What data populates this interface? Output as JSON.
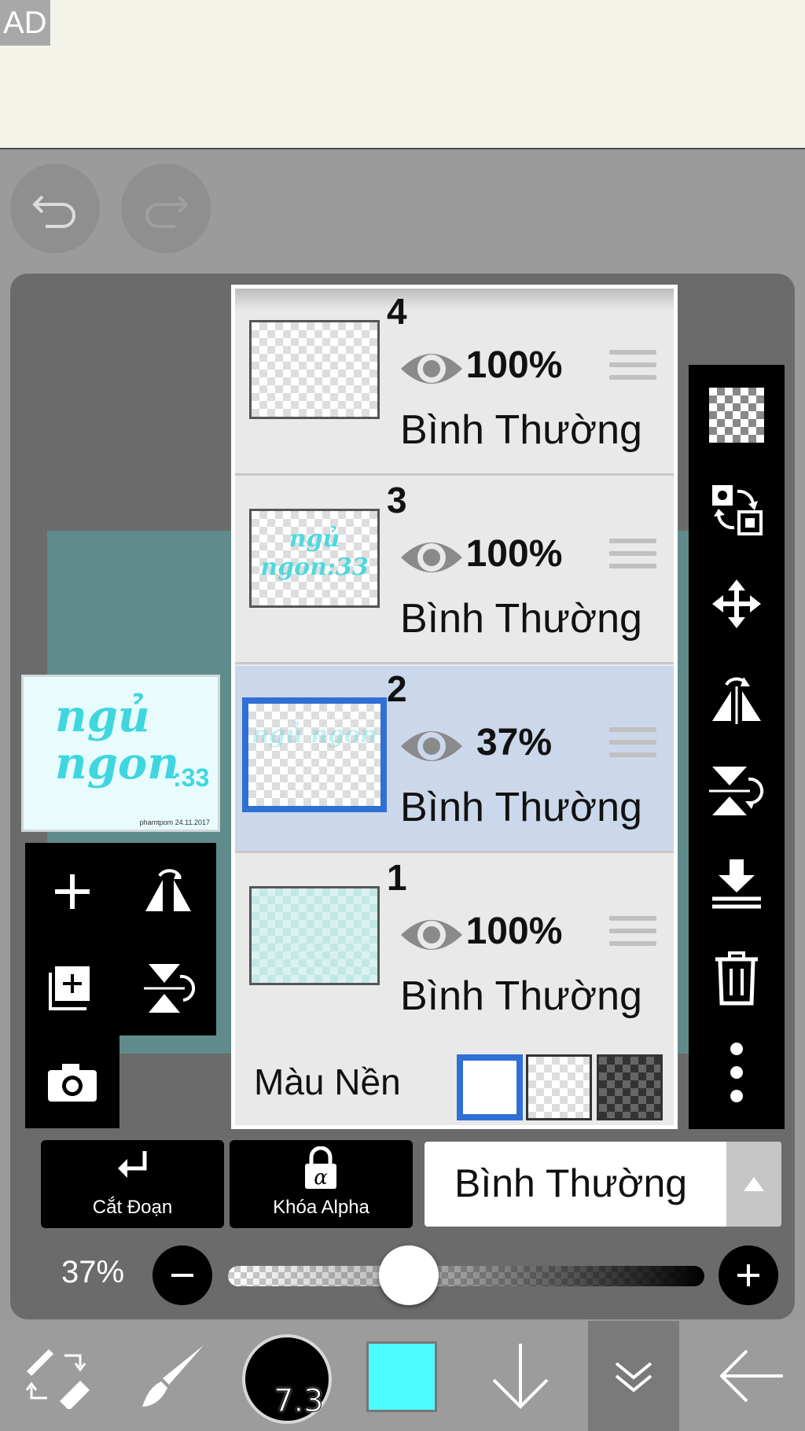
{
  "ad": {
    "label": "AD"
  },
  "layers": [
    {
      "number": "4",
      "opacity": "100%",
      "blend": "Bình Thường",
      "thumb_text": ""
    },
    {
      "number": "3",
      "opacity": "100%",
      "blend": "Bình Thường",
      "thumb_text": "ngủ ngon:33"
    },
    {
      "number": "2",
      "opacity": "37%",
      "blend": "Bình Thường",
      "thumb_text": "ngủ ngon",
      "selected": true
    },
    {
      "number": "1",
      "opacity": "100%",
      "blend": "Bình Thường",
      "thumb_text": ""
    }
  ],
  "background": {
    "label": "Màu Nền",
    "options": [
      "white",
      "transparent",
      "dark-checker"
    ],
    "selected": "white"
  },
  "canvas_preview": {
    "title": "ngủ ngon",
    "suffix": ":33",
    "credit": "phamtpom 24.11.2017"
  },
  "options": {
    "clipping_label": "Cắt Đoạn",
    "alpha_lock_label": "Khóa Alpha",
    "blend_mode": "Bình Thường"
  },
  "opacity": {
    "label": "37%",
    "value": 0.37
  },
  "toolbar": {
    "brush_size": "7.3",
    "color": "#4cfcff"
  }
}
